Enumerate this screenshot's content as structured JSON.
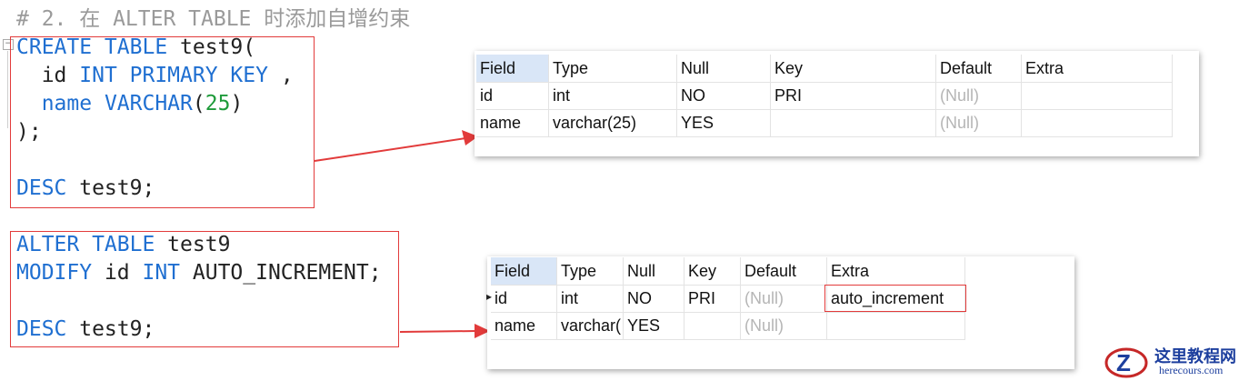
{
  "comment": "# 2. 在 ALTER TABLE 时添加自增约束",
  "code1": {
    "l1_kw": "CREATE TABLE",
    "l1_rest": " test9(",
    "l2_a": "  id ",
    "l2_kw": "INT PRIMARY KEY",
    "l2_rest": " ,",
    "l3_a": "  ",
    "l3_kw": "name VARCHAR",
    "l3_p1": "(",
    "l3_num": "25",
    "l3_p2": ")",
    "l4": ");",
    "l6_kw": "DESC",
    "l6_rest": " test9;"
  },
  "code2": {
    "l1_kw": "ALTER TABLE",
    "l1_rest": " test9",
    "l2_kw": "MODIFY",
    "l2_mid": " id ",
    "l2_kw2": "INT",
    "l2_rest": " AUTO_INCREMENT;",
    "l4_kw": "DESC",
    "l4_rest": " test9;"
  },
  "table1": {
    "headers": [
      "Field",
      "Type",
      "Null",
      "Key",
      "Default",
      "Extra"
    ],
    "rows": [
      [
        "id",
        "int",
        "NO",
        "PRI",
        "(Null)",
        ""
      ],
      [
        "name",
        "varchar(25)",
        "YES",
        "",
        "(Null)",
        ""
      ]
    ]
  },
  "table2": {
    "headers": [
      "Field",
      "Type",
      "Null",
      "Key",
      "Default",
      "Extra"
    ],
    "rows": [
      [
        "id",
        "int",
        "NO",
        "PRI",
        "(Null)",
        "auto_increment"
      ],
      [
        "name",
        "varchar(",
        "YES",
        "",
        "(Null)",
        ""
      ]
    ]
  },
  "watermark": {
    "title": "这里教程网",
    "url": "herecours.com"
  },
  "colors": {
    "keyword": "#1f6fd1",
    "number": "#1f9b3b",
    "annotation": "#e23b3b",
    "null_text": "#b5b5b5",
    "header_selected": "#d9e6f7",
    "watermark": "#1d3f9e"
  }
}
